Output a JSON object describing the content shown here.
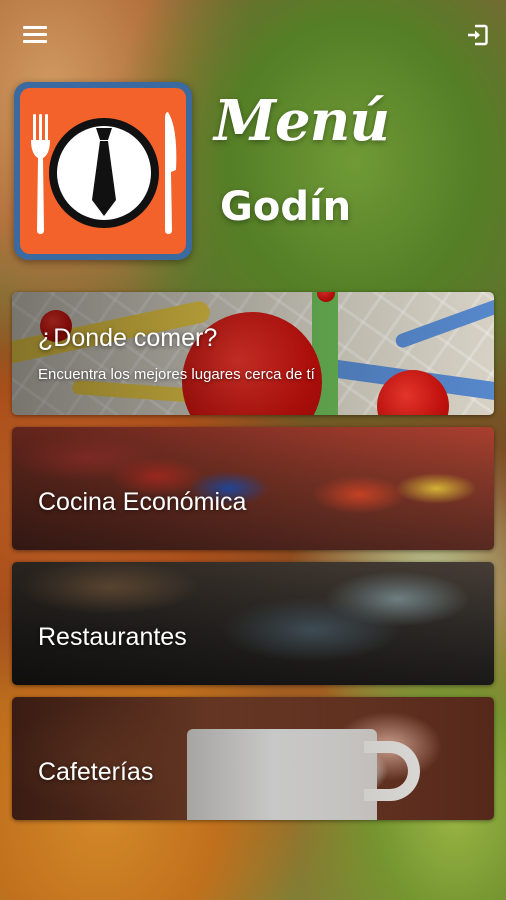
{
  "header": {
    "menu_icon": "hamburger-icon",
    "logout_icon": "logout-icon"
  },
  "brand": {
    "script_title": "Menú",
    "name": "Godín",
    "logo_icon": "plate-fork-knife-tie-icon",
    "logo_bg_color": "#f2622a",
    "logo_border_color": "#3b6aa0"
  },
  "categories": [
    {
      "title": "¿Donde comer?",
      "subtitle": "Encuentra los mejores lugares cerca de tí"
    },
    {
      "title": "Cocina Económica"
    },
    {
      "title": "Restaurantes"
    },
    {
      "title": "Cafeterías"
    }
  ]
}
